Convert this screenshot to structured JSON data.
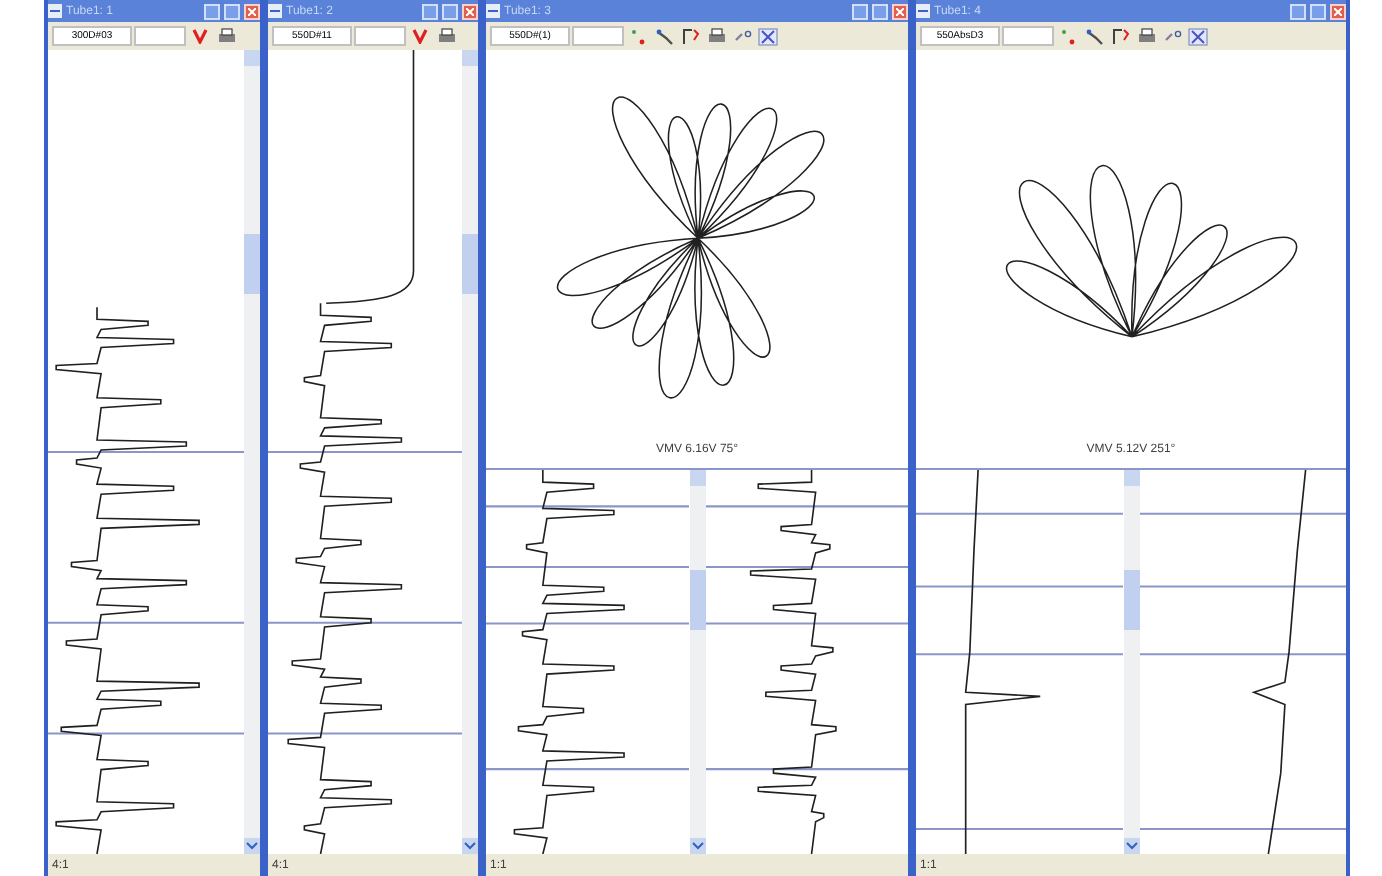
{
  "windows": [
    {
      "title": "Tube1: 1",
      "channel": "300D#03",
      "kind": "strip",
      "status": "4:1"
    },
    {
      "title": "Tube1: 2",
      "channel": "550D#11",
      "kind": "strip",
      "status": "4:1"
    },
    {
      "title": "Tube1: 3",
      "channel": "550D#(1)",
      "kind": "lissajous",
      "caption": "VMV 6.16V 75°",
      "status": "1:1"
    },
    {
      "title": "Tube1: 4",
      "channel": "550AbsD3",
      "kind": "lissajous",
      "caption": "VMV 5.12V 251°",
      "status": "1:1"
    }
  ]
}
